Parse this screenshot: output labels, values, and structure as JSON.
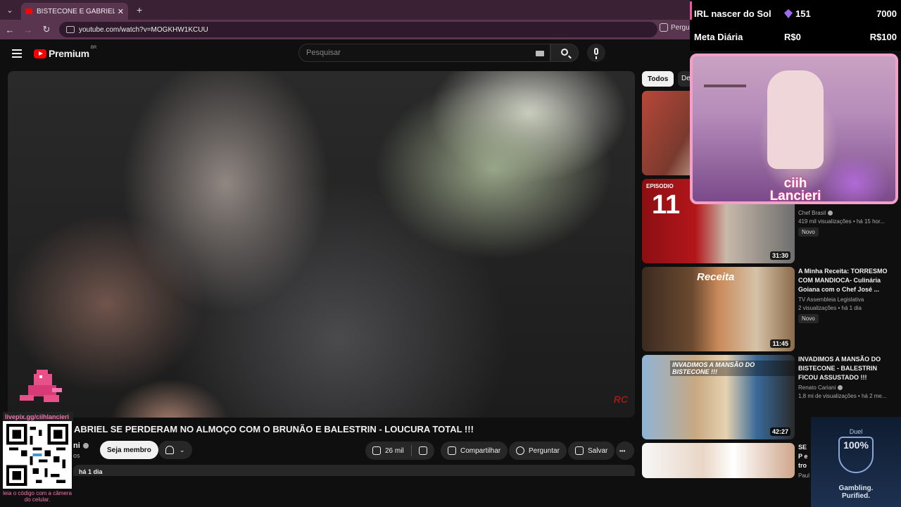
{
  "browser": {
    "tab_title": "BISTECONE E GABRIEL SE PERD",
    "tab_close": "✕",
    "new_tab": "+",
    "url": "youtube.com/watch?v=MOGKHW1KCUU",
    "ask_chip": "Pergu"
  },
  "header": {
    "logo_text": "Premium",
    "logo_region": "BR",
    "search_placeholder": "Pesquisar"
  },
  "video": {
    "watermark": "RC",
    "title": "ABRIEL SE PERDERAM NO ALMOÇO COM O BRUNÃO E BALESTRIN - LOUCURA TOTAL !!!",
    "channel_fragment": "ni",
    "subs_fragment": "os",
    "desc_fragment": "há 1 dia"
  },
  "actions": {
    "member": "Seja membro",
    "likes": "26 mil",
    "share": "Compartilhar",
    "ask": "Perguntar",
    "save": "Salvar",
    "more": "•••"
  },
  "sidebar": {
    "chips": [
      "Todos",
      "De"
    ],
    "items": [
      {
        "title": "",
        "channel": "",
        "views": "",
        "badge": "",
        "duration": ""
      },
      {
        "ep_label": "EPISODIO",
        "ep_num": "11",
        "title": "",
        "channel": "Chef Brasil",
        "views": "419 mil visualizações • há 15 hor...",
        "badge": "Novo",
        "duration": "31:30"
      },
      {
        "thumb_label": "Receita",
        "title": "A Minha Receita: TORRESMO COM MANDIOCA- Culinária Goiana com o Chef José ...",
        "channel": "TV Assembleia Legislativa",
        "views": "2 visualizações • há 1 dia",
        "badge": "Novo",
        "duration": "11:45"
      },
      {
        "thumb_label": "INVADIMOS A MANSÃO DO BISTECONE !!!",
        "title": "INVADIMOS A MANSÃO DO BISTECONE - BALESTRIN FICOU ASSUSTADO !!!",
        "channel": "Renato Cariani",
        "views": "1,8 mi de visualizações • há 2 me...",
        "duration": "42:27"
      },
      {
        "title": "SE P e tro",
        "channel": "Paulo"
      }
    ]
  },
  "overlay": {
    "goal1_label": "IRL nascer do Sol",
    "goal1_count": "151",
    "goal1_target": "7000",
    "goal2_label": "Meta Diária",
    "goal2_current": "R$0",
    "goal2_target": "R$100",
    "cam_name_line1": "ciih",
    "cam_name_line2": "Lancieri",
    "livepix_link": "livepix.gg/ciihlancieri",
    "qr_caption": "leia o código com a câmera do celular.",
    "duel_brand": "Duel",
    "duel_badge": "100%",
    "duel_tagline_1": "Gambling.",
    "duel_tagline_2": "Purified."
  },
  "colors": {
    "tab_bar": "#3a2234",
    "address_bar": "#5a3550",
    "yt_red": "#ff0000",
    "overlay_pink": "#f2a0c8",
    "gem_purple": "#9b6cf0"
  }
}
